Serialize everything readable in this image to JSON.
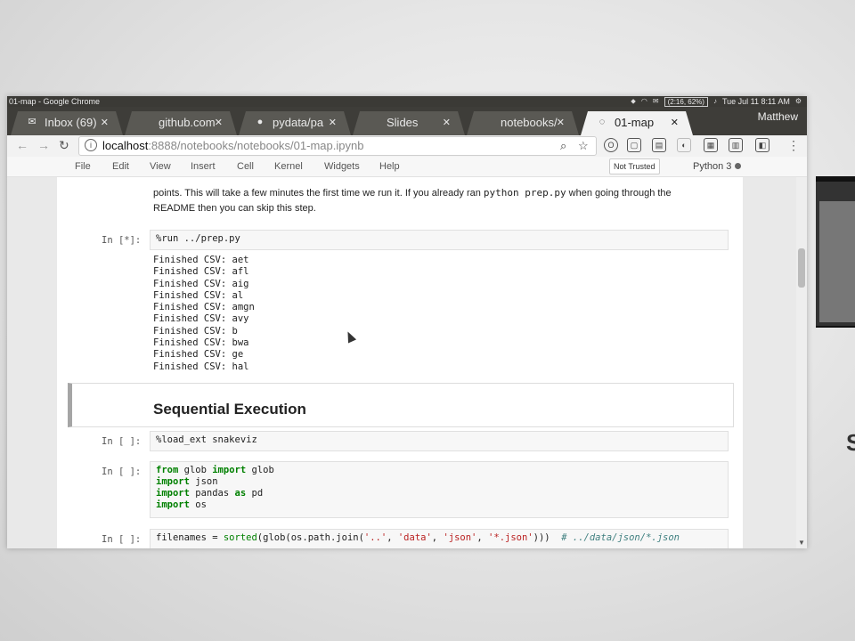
{
  "window_title": "01-map - Google Chrome",
  "tray": {
    "battery": "(2:16, 62%)",
    "clock": "Tue Jul 11  8:11 AM"
  },
  "tabs": [
    {
      "label": "Inbox (69)",
      "icon": "mail-icon",
      "active": false
    },
    {
      "label": "github.com",
      "icon": "page-icon",
      "active": false
    },
    {
      "label": "pydata/pa",
      "icon": "github-icon",
      "active": false
    },
    {
      "label": "Slides",
      "icon": "page-icon",
      "active": false
    },
    {
      "label": "notebooks/",
      "icon": "page-icon",
      "active": false
    },
    {
      "label": "01-map",
      "icon": "jupyter-icon",
      "active": true
    }
  ],
  "user": "Matthew",
  "address": {
    "host": "localhost",
    "rest": ":8888/notebooks/notebooks/01-map.ipynb"
  },
  "jupyter_menu": [
    "File",
    "Edit",
    "View",
    "Insert",
    "Cell",
    "Kernel",
    "Widgets",
    "Help"
  ],
  "trust_label": "Not Trusted",
  "kernel_label": "Python 3",
  "notebook": {
    "md_line1_pre": "points. This will take a few minutes the first time we run it. If you already ran ",
    "md_line1_code": "python prep.py",
    "md_line1_post": " when going through the",
    "md_line2": "README then you can skip this step.",
    "cell1_prompt": "In [*]:",
    "cell1_code": "%run ../prep.py",
    "cell1_output": [
      "Finished CSV: aet",
      "Finished CSV: afl",
      "Finished CSV: aig",
      "Finished CSV: al",
      "Finished CSV: amgn",
      "Finished CSV: avy",
      "Finished CSV: b",
      "Finished CSV: bwa",
      "Finished CSV: ge",
      "Finished CSV: hal"
    ],
    "heading": "Sequential Execution",
    "cell2_prompt": "In [ ]:",
    "cell2_code": "%load_ext snakeviz",
    "cell3_prompt": "In [ ]:",
    "cell3_lines": [
      {
        "kw1": "from",
        "mid": " glob ",
        "kw2": "import",
        "rest": " glob"
      },
      {
        "kw1": "import",
        "mid": " json",
        "kw2": "",
        "rest": ""
      },
      {
        "kw1": "import",
        "mid": " pandas ",
        "kw2": "as",
        "rest": " pd"
      },
      {
        "kw1": "import",
        "mid": " os",
        "kw2": "",
        "rest": ""
      }
    ],
    "cell4_prompt": "In [ ]:",
    "cell4_code_a": "filenames = ",
    "cell4_code_b": "sorted",
    "cell4_code_c": "(glob(os.path.join(",
    "cell4_str1": "'..'",
    "cell4_str2": "'data'",
    "cell4_str3": "'json'",
    "cell4_str4": "'*.json'",
    "cell4_code_d": ")))",
    "cell4_comment": "# ../data/json/*.json"
  },
  "colors": {
    "tabstrip": "#3e3d39",
    "active_tab": "#f2f2f2",
    "heading_border": "#a5a5a5"
  }
}
